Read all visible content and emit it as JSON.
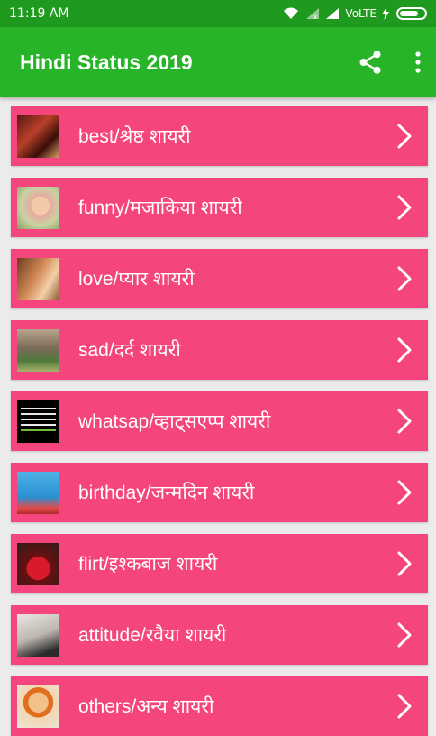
{
  "status_bar": {
    "time": "11:19 AM",
    "network": "VoLTE"
  },
  "app_bar": {
    "title": "Hindi Status 2019",
    "share_icon": "share-icon",
    "overflow_icon": "more-vertical-icon"
  },
  "colors": {
    "status_bar": "#1f9a1f",
    "app_bar": "#28b428",
    "item_background": "#f4457c",
    "page_background": "#ebebeb"
  },
  "items": [
    {
      "label": "best/श्रेष्ठ शायरी",
      "thumb": "best-thumbnail"
    },
    {
      "label": "funny/मजाकिया शायरी",
      "thumb": "funny-thumbnail"
    },
    {
      "label": "love/प्यार शायरी",
      "thumb": "love-thumbnail"
    },
    {
      "label": "sad/दर्द शायरी",
      "thumb": "sad-thumbnail"
    },
    {
      "label": "whatsap/व्हाट्सएप्प शायरी",
      "thumb": "whatsapp-thumbnail"
    },
    {
      "label": "birthday/जन्मदिन शायरी",
      "thumb": "birthday-thumbnail"
    },
    {
      "label": "flirt/इश्कबाज शायरी",
      "thumb": "flirt-thumbnail"
    },
    {
      "label": "attitude/रवैया शायरी",
      "thumb": "attitude-thumbnail"
    },
    {
      "label": "others/अन्य शायरी",
      "thumb": "others-thumbnail"
    }
  ]
}
